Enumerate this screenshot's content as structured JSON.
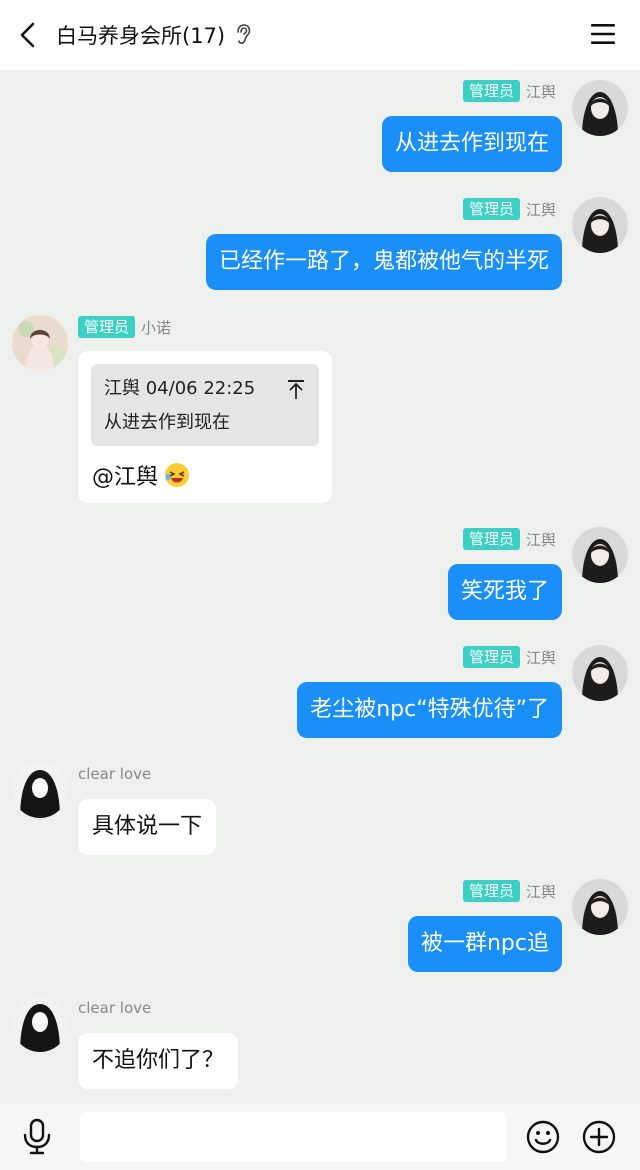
{
  "header": {
    "title": "白马养身会所(17)",
    "back_icon": "back-arrow-icon",
    "ear_icon": "ear-icon",
    "menu_icon": "menu-icon"
  },
  "messages": [
    {
      "side": "out",
      "badge": "管理员",
      "sender": "江舆",
      "text": "从进去作到现在"
    },
    {
      "side": "out",
      "badge": "管理员",
      "sender": "江舆",
      "text": "已经作一路了，鬼都被他气的半死"
    },
    {
      "side": "in",
      "badge": "管理员",
      "sender": "小诺",
      "quote": {
        "author_time": "江舆 04/06 22:25",
        "text": "从进去作到现在"
      },
      "text": "@江舆"
    },
    {
      "side": "out",
      "badge": "管理员",
      "sender": "江舆",
      "text": "笑死我了"
    },
    {
      "side": "out",
      "badge": "管理员",
      "sender": "江舆",
      "text": "老尘被npc“特殊优待”了"
    },
    {
      "side": "in",
      "sender": "clear love",
      "text": "具体说一下"
    },
    {
      "side": "out",
      "badge": "管理员",
      "sender": "江舆",
      "text": "被一群npc追"
    },
    {
      "side": "in",
      "sender": "clear love",
      "text": "不追你们了？"
    }
  ],
  "input_bar": {
    "placeholder": "",
    "mic_icon": "mic-icon",
    "emoji_icon": "smile-icon",
    "plus_icon": "plus-icon"
  },
  "colors": {
    "outgoing_bubble": "#1a8ff7",
    "admin_badge": "#3ccfc4",
    "background": "#edf0ed"
  }
}
